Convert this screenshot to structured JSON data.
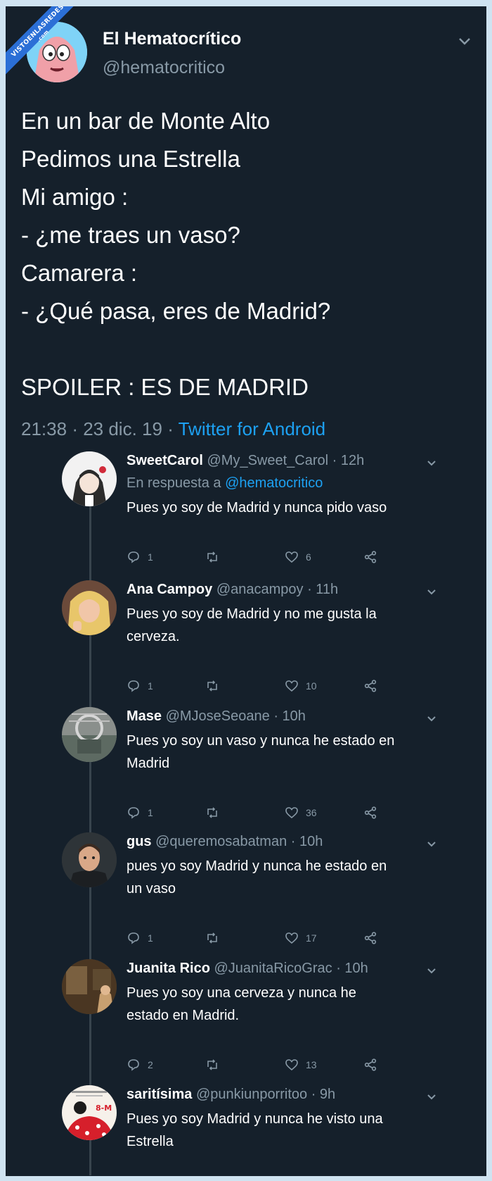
{
  "watermark": {
    "line1": "VISTOENLASREDES",
    "line2": ".com"
  },
  "tweet": {
    "author_name": "El Hematocrítico",
    "author_handle": "@hematocritico",
    "lines": [
      "En un bar de Monte Alto",
      "Pedimos una Estrella",
      "Mi amigo :",
      "- ¿me traes un vaso?",
      "Camarera :",
      "- ¿Qué pasa, eres de Madrid?",
      "",
      "SPOILER : ES DE MADRID"
    ],
    "time": "21:38",
    "date": "23 dic. 19",
    "source": "Twitter for Android"
  },
  "replies": [
    {
      "name": "SweetCarol",
      "handle": "@My_Sweet_Carol",
      "time": "12h",
      "in_reply_label": "En respuesta a",
      "in_reply_to": "@hematocritico",
      "lines": [
        "Pues yo soy de Madrid y nunca pido vaso"
      ],
      "replies": "1",
      "likes": "6"
    },
    {
      "name": "Ana Campoy",
      "handle": "@anacampoy",
      "time": "11h",
      "lines": [
        "Pues yo soy de Madrid y no me gusta la",
        "cerveza."
      ],
      "replies": "1",
      "likes": "10"
    },
    {
      "name": "Mase",
      "handle": "@MJoseSeoane",
      "time": "10h",
      "lines": [
        "Pues yo soy un vaso y nunca he estado en",
        "Madrid"
      ],
      "replies": "1",
      "likes": "36"
    },
    {
      "name": "gus",
      "handle": "@queremosabatman",
      "time": "10h",
      "lines": [
        "pues yo soy Madrid y nunca he estado en",
        "un vaso"
      ],
      "replies": "1",
      "likes": "17"
    },
    {
      "name": "Juanita Rico",
      "handle": "@JuanitaRicoGrac",
      "time": "10h",
      "lines": [
        "Pues yo soy una cerveza y nunca he",
        "estado en Madrid."
      ],
      "replies": "2",
      "likes": "13"
    },
    {
      "name": "saritísima",
      "handle": "@punkiunporritoo",
      "time": "9h",
      "lines": [
        "Pues yo soy Madrid y nunca he visto una",
        "Estrella"
      ],
      "avatar_text": "8-M"
    }
  ],
  "colors": {
    "background": "#15202b",
    "text_primary": "#ffffff",
    "text_secondary": "#8899a6",
    "accent": "#1da1f2"
  }
}
